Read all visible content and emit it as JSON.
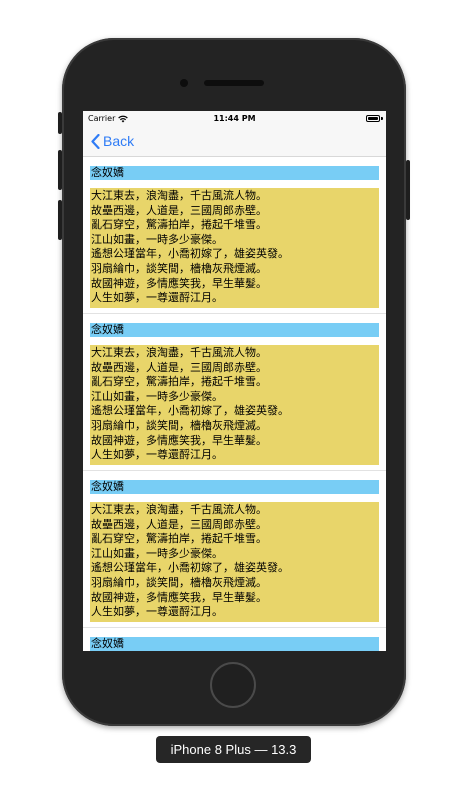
{
  "status_bar": {
    "carrier": "Carrier",
    "time": "11:44 PM",
    "icons": [
      "wifi-icon",
      "battery-icon"
    ]
  },
  "nav": {
    "back_label": "Back",
    "back_icon": "chevron-left-icon",
    "accent_color": "#2f7cf6"
  },
  "colors": {
    "title_background": "#78cdf5",
    "body_background": "#e8d56a"
  },
  "poems": [
    {
      "title": "念奴嬌",
      "lines": [
        "大江東去，浪淘盡，千古風流人物。",
        "故壘西邊，人道是，三國周郎赤壁。",
        "亂石穿空，驚濤拍岸，捲起千堆雪。",
        "江山如畫，一時多少豪傑。",
        "遙想公瑾當年，小喬初嫁了，雄姿英發。",
        "羽扇綸巾，談笑間，檣櫓灰飛煙滅。",
        "故國神遊，多情應笑我，早生華髮。",
        "人生如夢，一尊還酹江月。"
      ]
    },
    {
      "title": "念奴嬌",
      "lines": [
        "大江東去，浪淘盡，千古風流人物。",
        "故壘西邊，人道是，三國周郎赤壁。",
        "亂石穿空，驚濤拍岸，捲起千堆雪。",
        "江山如畫，一時多少豪傑。",
        "遙想公瑾當年，小喬初嫁了，雄姿英發。",
        "羽扇綸巾，談笑間，檣櫓灰飛煙滅。",
        "故國神遊，多情應笑我，早生華髮。",
        "人生如夢，一尊還酹江月。"
      ]
    },
    {
      "title": "念奴嬌",
      "lines": [
        "大江東去，浪淘盡，千古風流人物。",
        "故壘西邊，人道是，三國周郎赤壁。",
        "亂石穿空，驚濤拍岸，捲起千堆雪。",
        "江山如畫，一時多少豪傑。",
        "遙想公瑾當年，小喬初嫁了，雄姿英發。",
        "羽扇綸巾，談笑間，檣櫓灰飛煙滅。",
        "故國神遊，多情應笑我，早生華髮。",
        "人生如夢，一尊還酹江月。"
      ]
    },
    {
      "title": "念奴嬌",
      "lines": []
    }
  ],
  "device_label": "iPhone 8 Plus — 13.3"
}
